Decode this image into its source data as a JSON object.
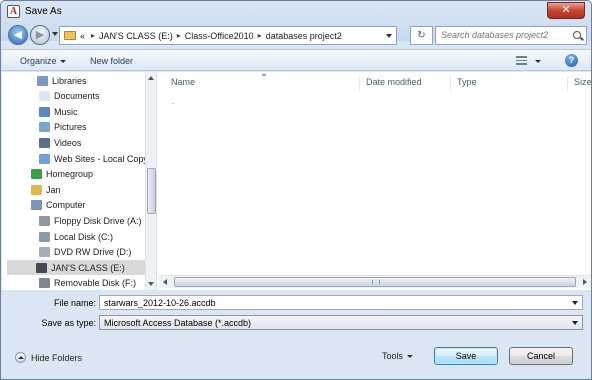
{
  "window": {
    "title": "Save As",
    "app_icon_letter": "A",
    "close_glyph": "✕"
  },
  "address": {
    "prefix": "«",
    "crumbs": [
      "JAN'S CLASS (E:)",
      "Class-Office2010",
      "databases project2"
    ],
    "separator": "▸"
  },
  "search": {
    "placeholder": "Search databases project2"
  },
  "toolbar": {
    "organize": "Organize",
    "new_folder": "New folder",
    "help": "?"
  },
  "nav_tree": [
    {
      "label": "Libraries",
      "icon": "libraries-icon",
      "color": "#7b9bc6"
    },
    {
      "label": "Documents",
      "icon": "documents-icon",
      "color": "#dfe6ef"
    },
    {
      "label": "Music",
      "icon": "music-icon",
      "color": "#5a86c4"
    },
    {
      "label": "Pictures",
      "icon": "pictures-icon",
      "color": "#7aa7c9"
    },
    {
      "label": "Videos",
      "icon": "videos-icon",
      "color": "#5a6f8a"
    },
    {
      "label": "Web Sites - Local Copy",
      "icon": "web-sites-icon",
      "color": "#6fa0d8"
    },
    {
      "label": "Homegroup",
      "icon": "homegroup-icon",
      "color": "#3aa04a"
    },
    {
      "label": "Jan",
      "icon": "user-folder-icon",
      "color": "#e2b84c"
    },
    {
      "label": "Computer",
      "icon": "computer-icon",
      "color": "#7b95b8"
    },
    {
      "label": "Floppy Disk Drive (A:)",
      "icon": "floppy-icon",
      "color": "#8e98a6"
    },
    {
      "label": "Local Disk (C:)",
      "icon": "local-disk-icon",
      "color": "#8a9aa8"
    },
    {
      "label": "DVD RW Drive (D:)",
      "icon": "dvd-drive-icon",
      "color": "#a4adb8"
    },
    {
      "label": "JAN'S CLASS (E:)",
      "icon": "usb-drive-icon",
      "color": "#444a52",
      "selected": true
    },
    {
      "label": "Removable Disk (F:)",
      "icon": "removable-disk-icon",
      "color": "#7e8894"
    }
  ],
  "columns": [
    "Name",
    "Date modified",
    "Type",
    "Size"
  ],
  "empty_marker": ".",
  "file_name": {
    "label": "File name:",
    "value": "starwars_2012-10-26.accdb"
  },
  "save_as_type": {
    "label": "Save as type:",
    "value": "Microsoft Access Database (*.accdb)"
  },
  "footer": {
    "hide_folders": "Hide Folders",
    "tools": "Tools",
    "save": "Save",
    "cancel": "Cancel"
  }
}
